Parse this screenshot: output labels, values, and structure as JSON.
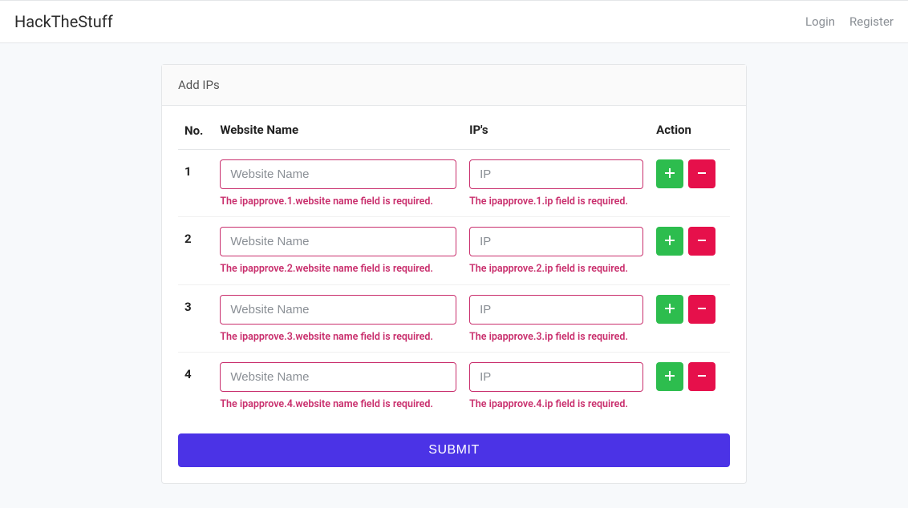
{
  "nav": {
    "brand": "HackTheStuff",
    "login": "Login",
    "register": "Register"
  },
  "card": {
    "title": "Add IPs"
  },
  "table": {
    "headers": {
      "no": "No.",
      "website": "Website Name",
      "ip": "IP's",
      "action": "Action"
    },
    "rows": [
      {
        "no": "1",
        "website_placeholder": "Website Name",
        "website_value": "",
        "website_error": "The ipapprove.1.website name field is required.",
        "ip_placeholder": "IP",
        "ip_value": "",
        "ip_error": "The ipapprove.1.ip field is required."
      },
      {
        "no": "2",
        "website_placeholder": "Website Name",
        "website_value": "",
        "website_error": "The ipapprove.2.website name field is required.",
        "ip_placeholder": "IP",
        "ip_value": "",
        "ip_error": "The ipapprove.2.ip field is required."
      },
      {
        "no": "3",
        "website_placeholder": "Website Name",
        "website_value": "",
        "website_error": "The ipapprove.3.website name field is required.",
        "ip_placeholder": "IP",
        "ip_value": "",
        "ip_error": "The ipapprove.3.ip field is required."
      },
      {
        "no": "4",
        "website_placeholder": "Website Name",
        "website_value": "",
        "website_error": "The ipapprove.4.website name field is required.",
        "ip_placeholder": "IP",
        "ip_value": "",
        "ip_error": "The ipapprove.4.ip field is required."
      }
    ]
  },
  "buttons": {
    "submit": "SUBMIT"
  },
  "icons": {
    "plus": "plus-icon",
    "minus": "minus-icon"
  },
  "colors": {
    "accent": "#4b33e6",
    "success": "#2dbd4e",
    "danger": "#e6104b",
    "error_text": "#c92f6d"
  }
}
